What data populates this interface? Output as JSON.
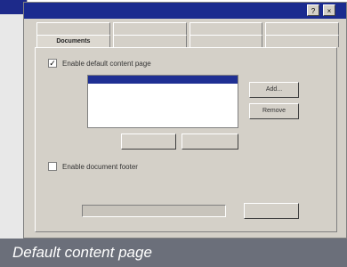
{
  "dialog": {
    "title": "",
    "tabs_row1": [
      "",
      "",
      "",
      ""
    ],
    "tabs_row2": [
      "Documents",
      "",
      "",
      ""
    ],
    "active_tab": "Documents",
    "enable_default_label": "Enable default content page",
    "enable_default_checked": true,
    "list_items": [
      "",
      "",
      "",
      ""
    ],
    "selected_index": 0,
    "add_label": "Add...",
    "remove_label": "Remove",
    "move_up_label": "",
    "move_down_label": "",
    "enable_footer_label": "Enable document footer",
    "enable_footer_checked": false,
    "footer_description": "",
    "footer_path": "",
    "browse_label": ""
  },
  "caption": "Default content page"
}
